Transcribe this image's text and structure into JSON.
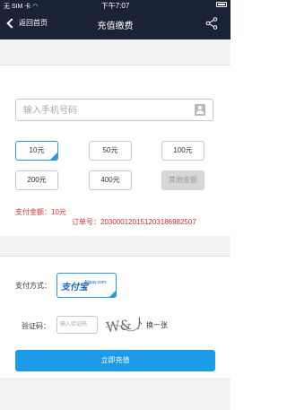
{
  "status_bar": {
    "carrier": "无 SIM 卡 ",
    "time": "下午7:07"
  },
  "nav": {
    "back_label": "返回首页",
    "title": "充值缴费",
    "icons": {
      "back": "chevron-left-icon",
      "share": "share-icon"
    }
  },
  "phone": {
    "placeholder": "输入手机号码",
    "value": "",
    "contact_icon": "contact-book-icon"
  },
  "amounts": {
    "options": [
      "10元",
      "50元",
      "100元",
      "200元",
      "400元",
      "其他金额"
    ],
    "selected": "10元",
    "disabled": "其他金额"
  },
  "summary": {
    "pay_amount_label": "支付金额：",
    "pay_amount_value": "10元",
    "order_label": "订单号：",
    "order_value": "20300012015120318698250​7"
  },
  "payment": {
    "method_label": "支付方式：",
    "alipay_logo": "支付宝",
    "alipay_sub": "Alipay.com"
  },
  "captcha": {
    "label": "验证码：",
    "placeholder": "输入验证码",
    "image_text": "W& 从",
    "refresh_label": "换一张"
  },
  "submit": {
    "label": "立即充值"
  },
  "colors": {
    "nav_bg": "#1a2238",
    "accent": "#1c9be8",
    "error_text": "#d23030",
    "page_gap": "#f2f2f4"
  }
}
